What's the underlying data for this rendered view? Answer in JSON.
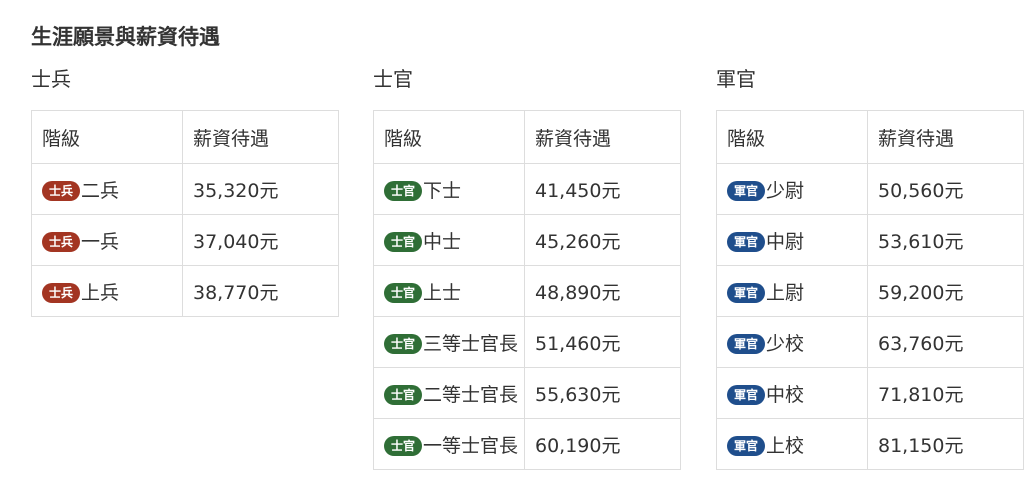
{
  "section_title": "生涯願景與薪資待遇",
  "colors": {
    "soldier": "#a33522",
    "nco": "#2f6e36",
    "officer": "#1f4e8c"
  },
  "headers": {
    "rank": "階級",
    "salary": "薪資待遇"
  },
  "groups": [
    {
      "title": "士兵",
      "badge": "士兵",
      "rows": [
        {
          "rank": "二兵",
          "salary": "35,320元"
        },
        {
          "rank": "一兵",
          "salary": "37,040元"
        },
        {
          "rank": "上兵",
          "salary": "38,770元"
        }
      ]
    },
    {
      "title": "士官",
      "badge": "士官",
      "rows": [
        {
          "rank": "下士",
          "salary": "41,450元"
        },
        {
          "rank": "中士",
          "salary": "45,260元"
        },
        {
          "rank": "上士",
          "salary": "48,890元"
        },
        {
          "rank": "三等士官長",
          "salary": "51,460元"
        },
        {
          "rank": "二等士官長",
          "salary": "55,630元"
        },
        {
          "rank": "一等士官長",
          "salary": "60,190元"
        }
      ]
    },
    {
      "title": "軍官",
      "badge": "軍官",
      "rows": [
        {
          "rank": "少尉",
          "salary": "50,560元"
        },
        {
          "rank": "中尉",
          "salary": "53,610元"
        },
        {
          "rank": "上尉",
          "salary": "59,200元"
        },
        {
          "rank": "少校",
          "salary": "63,760元"
        },
        {
          "rank": "中校",
          "salary": "71,810元"
        },
        {
          "rank": "上校",
          "salary": "81,150元"
        }
      ]
    }
  ]
}
